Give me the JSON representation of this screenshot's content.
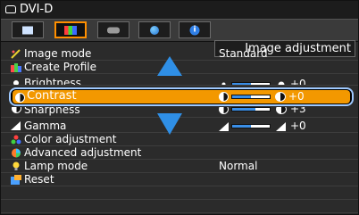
{
  "header": {
    "title": "DVI-D",
    "section_heading": "Image adjustment"
  },
  "tabs": [
    {
      "name": "picture",
      "icon": "screen-icon",
      "selected": false
    },
    {
      "name": "color",
      "icon": "color-bars-icon",
      "selected": true
    },
    {
      "name": "setup",
      "icon": "gamepad-icon",
      "selected": false
    },
    {
      "name": "network",
      "icon": "globe-icon",
      "selected": false
    },
    {
      "name": "info",
      "icon": "info-icon",
      "selected": false
    }
  ],
  "menu": {
    "items": [
      {
        "label": "Image mode",
        "value": "Standard"
      },
      {
        "label": "Create Profile"
      },
      {
        "label": "Brightness",
        "value": "+0",
        "level": 0.5
      },
      {
        "label": "Contrast",
        "value": "+0",
        "level": 0.5
      },
      {
        "label": "Sharpness",
        "value": "+3",
        "level": 0.62
      },
      {
        "label": "Gamma",
        "value": "+0",
        "level": 0.5
      },
      {
        "label": "Color adjustment"
      },
      {
        "label": "Advanced adjustment"
      },
      {
        "label": "Lamp mode",
        "value": "Normal"
      },
      {
        "label": "Reset"
      }
    ]
  },
  "colors": {
    "highlight": "#f39800",
    "focus_border": "#9ec9ff",
    "arrow": "#2f8fe6",
    "slider_fill": "#3a8ee6"
  }
}
